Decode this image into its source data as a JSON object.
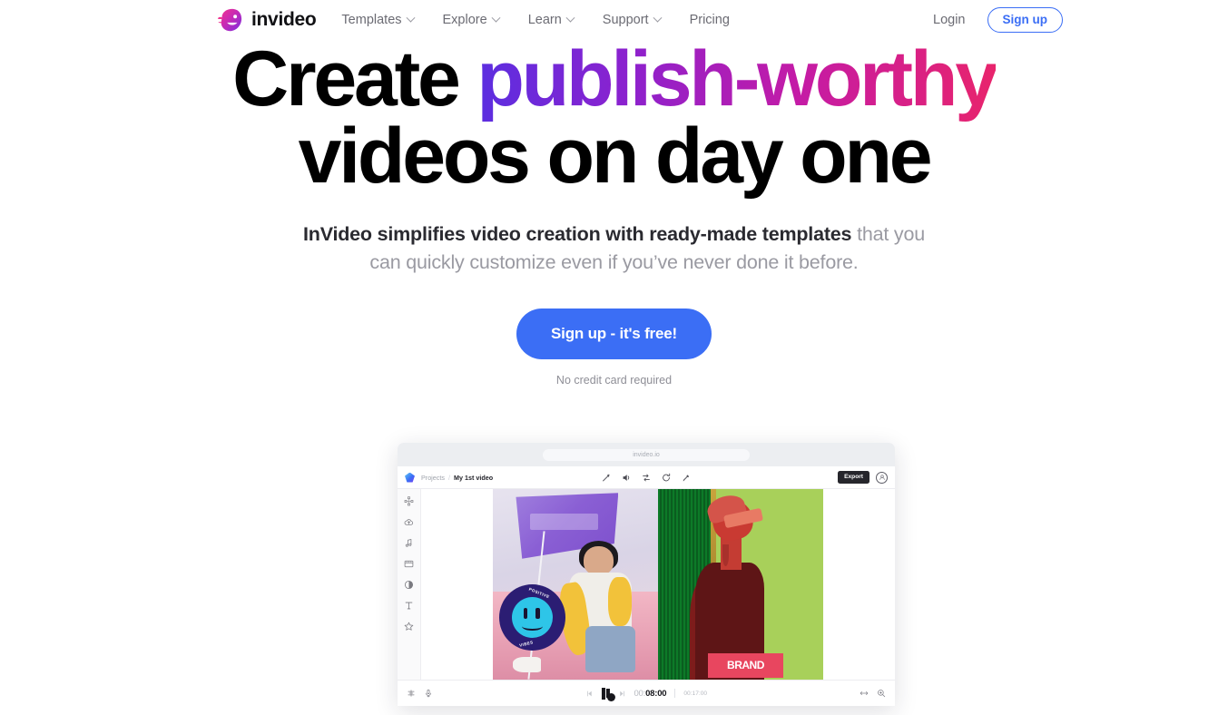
{
  "nav": {
    "brand": "invideo",
    "brand_icon": "invideo-bird-logo",
    "links": [
      {
        "label": "Templates",
        "has_chevron": true
      },
      {
        "label": "Explore",
        "has_chevron": true
      },
      {
        "label": "Learn",
        "has_chevron": true
      },
      {
        "label": "Support",
        "has_chevron": true
      },
      {
        "label": "Pricing",
        "has_chevron": false
      }
    ],
    "login_label": "Login",
    "signup_label": "Sign up"
  },
  "hero": {
    "headline_part1": "Create ",
    "headline_gradient": "publish-worthy",
    "headline_line2": "videos on day one",
    "subhead_strong": "InVideo simplifies video creation with ready-made templates",
    "subhead_rest": " that you can quickly customize even if you’ve never done it before.",
    "cta_label": "Sign up - it's free!",
    "cta_note": "No credit card required"
  },
  "editor_mockup": {
    "browser_url": "invideo.io",
    "breadcrumb_root": "Projects",
    "breadcrumb_sep": "/",
    "breadcrumb_current": "My 1st video",
    "header_tools": [
      "magic-wand-icon",
      "volume-icon",
      "transition-icon",
      "rotate-icon",
      "brush-icon"
    ],
    "export_label": "Export",
    "avatar_icon": "user-avatar-icon",
    "sidebar_icons": [
      "templates-grid-icon",
      "cloud-upload-icon",
      "music-note-icon",
      "media-film-icon",
      "filter-contrast-icon",
      "text-tool-icon",
      "effects-star-icon"
    ],
    "preview": {
      "left_clip_badge_top": "POSITIVE",
      "left_clip_badge_bottom": "VIBES",
      "right_clip_overlay": "BRAND"
    },
    "timeline": {
      "time_prefix": "00:",
      "time_current": "08:00",
      "time_total": "00:17:00",
      "left_icons": [
        "layers-icon",
        "mic-icon"
      ],
      "right_icons": [
        "fit-width-icon",
        "zoom-in-icon"
      ],
      "transport_icons": [
        "skip-prev-icon",
        "split-icon",
        "skip-next-icon"
      ]
    }
  },
  "colors": {
    "accent_blue": "#3b6ef5",
    "gradient_start": "#5b2ee0",
    "gradient_end": "#e8246c",
    "text_dark": "#111114",
    "text_muted": "#9a9aa2"
  }
}
